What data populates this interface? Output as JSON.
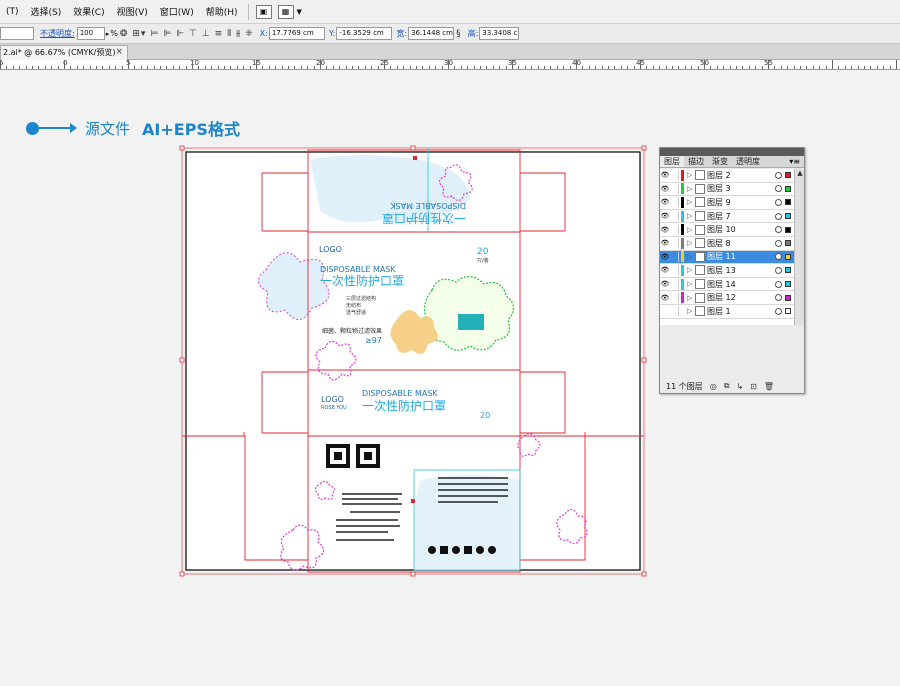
{
  "menubar": {
    "items": [
      "(T)",
      "选择(S)",
      "效果(C)",
      "视图(V)",
      "窗口(W)",
      "帮助(H)"
    ]
  },
  "control_bar": {
    "opacity_label": "不透明度:",
    "opacity_value": "100",
    "opacity_unit": "%",
    "x_label": "X:",
    "x_value": "17.7769 cm",
    "y_label": "Y:",
    "y_value": "-16.3529 cm",
    "w_label": "宽:",
    "w_value": "36.1448 cm",
    "h_label": "高:",
    "h_value": "33.3408 cm"
  },
  "document_tab": {
    "title": "2.ai* @ 66.67% (CMYK/预览)",
    "close": "×"
  },
  "ruler": {
    "labels": [
      "5",
      "0",
      "5",
      "10",
      "15",
      "20",
      "25",
      "30",
      "35",
      "40",
      "45",
      "50",
      "55"
    ]
  },
  "annotation": {
    "label_cn": "源文件",
    "label_format": "AI+EPS格式"
  },
  "artwork": {
    "title_cn": "一次性防护口罩",
    "title_en": "DISPOSABLE MASK",
    "logo": "LOGO",
    "logo_sub": "ROSE YOU",
    "count": "20",
    "count_label": "只/装",
    "filter_text": "细菌、颗粒物过滤效果",
    "filter_value": "≥97",
    "features": [
      "三层过滤结构",
      "无纺布",
      "透气舒适"
    ],
    "top_small": "一次性防护口罩"
  },
  "layers_panel": {
    "tabs": [
      "图层",
      "描边",
      "渐变",
      "透明度"
    ],
    "layers": [
      {
        "name": "图层 2",
        "color": "#e01e1e",
        "selected": false
      },
      {
        "name": "图层 3",
        "color": "#1fcf2f",
        "selected": false
      },
      {
        "name": "图层 9",
        "color": "#000000",
        "selected": false
      },
      {
        "name": "图层 7",
        "color": "#27c9d4",
        "selected": false
      },
      {
        "name": "图层 10",
        "color": "#000000",
        "selected": false
      },
      {
        "name": "图层 8",
        "color": "#7a7a7a",
        "selected": false
      },
      {
        "name": "图层 11",
        "color": "#f0d020",
        "selected": true
      },
      {
        "name": "图层 13",
        "color": "#27c9d4",
        "selected": false
      },
      {
        "name": "图层 14",
        "color": "#27c9d4",
        "selected": false
      },
      {
        "name": "图层 12",
        "color": "#c428c9",
        "selected": false
      },
      {
        "name": "图层 1",
        "color": "#ffffff",
        "selected": false
      }
    ],
    "footer": "11 个图层"
  },
  "colors": {
    "accent": "#1b86cf",
    "dieline": "#e3262f",
    "cyan_guide": "#27c9d4",
    "magenta_path": "#e03ad9",
    "green_path": "#22c23a"
  }
}
